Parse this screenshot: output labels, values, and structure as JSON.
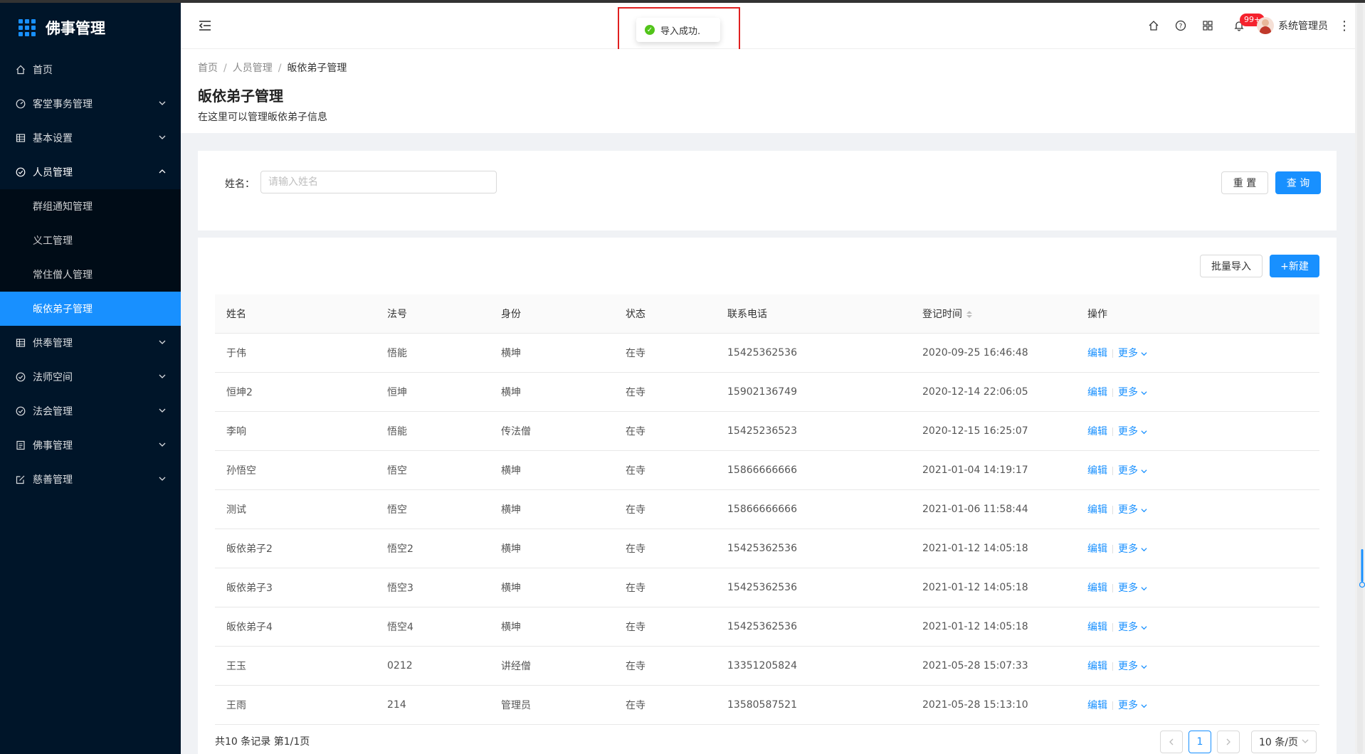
{
  "app": {
    "title": "佛事管理"
  },
  "sidebar": {
    "items": [
      {
        "label": "首页",
        "icon": "home-icon",
        "arrow": false
      },
      {
        "label": "客堂事务管理",
        "icon": "dashboard-icon",
        "arrow": true
      },
      {
        "label": "基本设置",
        "icon": "table-icon",
        "arrow": true
      },
      {
        "label": "人员管理",
        "icon": "check-circle-icon",
        "arrow": true,
        "open": true,
        "children": [
          {
            "label": "群组通知管理"
          },
          {
            "label": "义工管理"
          },
          {
            "label": "常住僧人管理"
          },
          {
            "label": "皈依弟子管理",
            "active": true
          }
        ]
      },
      {
        "label": "供奉管理",
        "icon": "table-icon",
        "arrow": true
      },
      {
        "label": "法师空间",
        "icon": "check-circle-icon",
        "arrow": true
      },
      {
        "label": "法会管理",
        "icon": "check-circle-icon",
        "arrow": true
      },
      {
        "label": "佛事管理",
        "icon": "profile-icon",
        "arrow": true
      },
      {
        "label": "慈善管理",
        "icon": "form-icon",
        "arrow": true
      }
    ]
  },
  "header": {
    "notification_count": "99+",
    "username": "系统管理员"
  },
  "toast": {
    "message": "导入成功."
  },
  "page": {
    "breadcrumb": [
      "首页",
      "人员管理",
      "皈依弟子管理"
    ],
    "title": "皈依弟子管理",
    "description": "在这里可以管理皈依弟子信息"
  },
  "search": {
    "name_label": "姓名：",
    "name_placeholder": "请输入姓名",
    "name_value": "",
    "reset_label": "重 置",
    "query_label": "查 询"
  },
  "toolbar": {
    "import_label": "批量导入",
    "new_label": "+新建"
  },
  "table": {
    "columns": [
      "姓名",
      "法号",
      "身份",
      "状态",
      "联系电话",
      "登记时间",
      "操作"
    ],
    "edit_label": "编辑",
    "more_label": "更多",
    "rows": [
      [
        "于伟",
        "悟能",
        "横坤",
        "在寺",
        "15425362536",
        "2020-09-25 16:46:48"
      ],
      [
        "恒坤2",
        "恒坤",
        "横坤",
        "在寺",
        "15902136749",
        "2020-12-14 22:06:05"
      ],
      [
        "李响",
        "悟能",
        "传法僧",
        "在寺",
        "15425236523",
        "2020-12-15 16:25:07"
      ],
      [
        "孙悟空",
        "悟空",
        "横坤",
        "在寺",
        "15866666666",
        "2021-01-04 14:19:17"
      ],
      [
        "测试",
        "悟空",
        "横坤",
        "在寺",
        "15866666666",
        "2021-01-06 11:58:44"
      ],
      [
        "皈依弟子2",
        "悟空2",
        "横坤",
        "在寺",
        "15425362536",
        "2021-01-12 14:05:18"
      ],
      [
        "皈依弟子3",
        "悟空3",
        "横坤",
        "在寺",
        "15425362536",
        "2021-01-12 14:05:18"
      ],
      [
        "皈依弟子4",
        "悟空4",
        "横坤",
        "在寺",
        "15425362536",
        "2021-01-12 14:05:18"
      ],
      [
        "王玉",
        "0212",
        "讲经僧",
        "在寺",
        "13351205824",
        "2021-05-28 15:07:33"
      ],
      [
        "王雨",
        "214",
        "管理员",
        "在寺",
        "13580587521",
        "2021-05-28 15:13:10"
      ]
    ]
  },
  "pagination": {
    "summary": "共10 条记录 第1/1页",
    "current_page": "1",
    "page_size": "10 条/页"
  },
  "colors": {
    "primary": "#1890ff",
    "sidebar_bg": "#001529",
    "success": "#52c41a",
    "highlight": "#e02020"
  }
}
